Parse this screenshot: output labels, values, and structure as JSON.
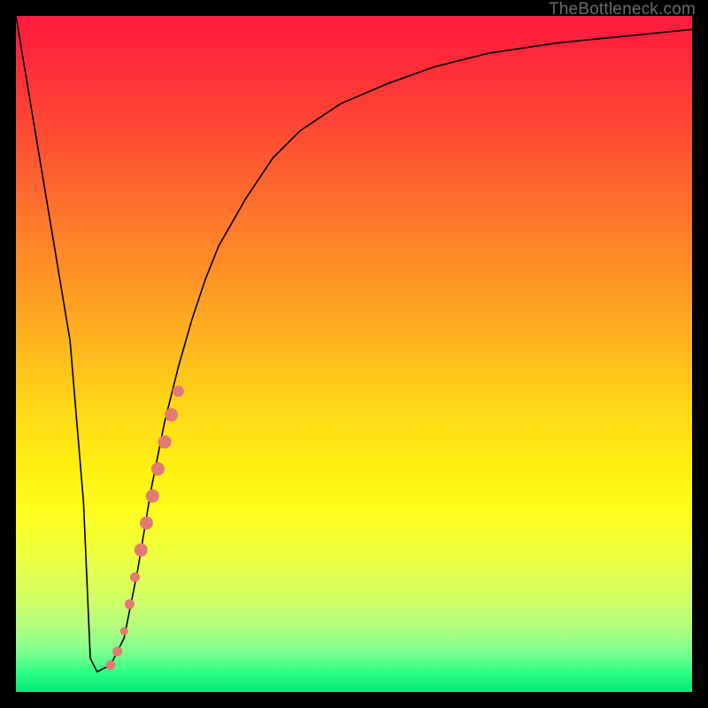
{
  "watermark": "TheBottleneck.com",
  "colors": {
    "frame": "#000000",
    "curve": "#000000",
    "dots": "#e37a71",
    "gradient_top": "#ff1a3f",
    "gradient_bottom": "#00e676"
  },
  "chart_data": {
    "type": "line",
    "title": "",
    "xlabel": "",
    "ylabel": "",
    "xlim": [
      0,
      100
    ],
    "ylim": [
      0,
      100
    ],
    "grid": false,
    "legend": false,
    "series": [
      {
        "name": "bottleneck-curve",
        "x": [
          0,
          2,
          4,
          6,
          8,
          10,
          11,
          12,
          14,
          16,
          18,
          20,
          22,
          24,
          26,
          28,
          30,
          34,
          38,
          42,
          48,
          55,
          62,
          70,
          80,
          90,
          100
        ],
        "y": [
          100,
          88,
          76,
          64,
          52,
          28,
          5,
          3,
          4,
          8,
          18,
          30,
          40,
          48,
          55,
          61,
          66,
          73,
          79,
          83,
          87,
          90,
          92.5,
          94.5,
          96,
          97,
          98
        ]
      }
    ],
    "highlight_points": {
      "name": "highlight-dots",
      "points": [
        {
          "x": 14.0,
          "y": 4.0,
          "r": 5
        },
        {
          "x": 15.0,
          "y": 6.0,
          "r": 5
        },
        {
          "x": 16.0,
          "y": 9.0,
          "r": 4
        },
        {
          "x": 16.8,
          "y": 13.0,
          "r": 5
        },
        {
          "x": 17.6,
          "y": 17.0,
          "r": 5
        },
        {
          "x": 18.5,
          "y": 21.0,
          "r": 7
        },
        {
          "x": 19.3,
          "y": 25.0,
          "r": 7
        },
        {
          "x": 20.2,
          "y": 29.0,
          "r": 7
        },
        {
          "x": 21.0,
          "y": 33.0,
          "r": 7
        },
        {
          "x": 22.0,
          "y": 37.0,
          "r": 7
        },
        {
          "x": 23.0,
          "y": 41.0,
          "r": 7
        },
        {
          "x": 24.0,
          "y": 44.5,
          "r": 6
        }
      ]
    }
  }
}
